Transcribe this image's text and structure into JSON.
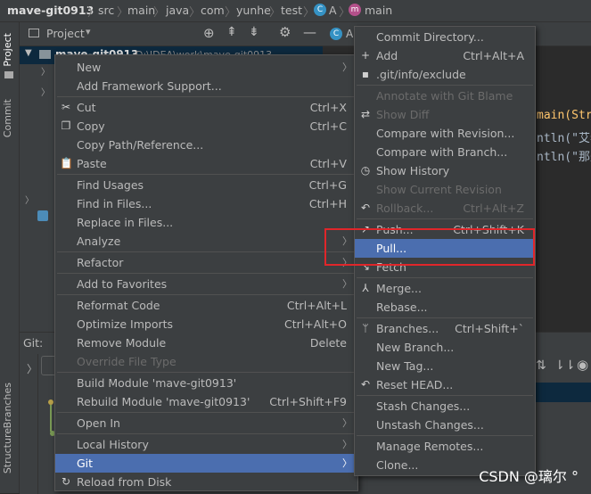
{
  "breadcrumb": [
    "mave-git0913",
    "src",
    "main",
    "java",
    "com",
    "yunhe",
    "test",
    "A",
    "main"
  ],
  "side_tabs": {
    "project": "Project",
    "commit": "Commit",
    "branches": "Branches",
    "structure": "Structure"
  },
  "project_panel": {
    "title": "Project",
    "root_name": "mave-git0913",
    "root_path": "D:\\IDEA\\work\\mave-git0913"
  },
  "editor": {
    "tab": "A",
    "line1": "main(Str",
    "line2": "ntln(\"艾老",
    "line3": "ntln(\"那是"
  },
  "git_panel": {
    "label": "Git:"
  },
  "context_menu": {
    "items": [
      {
        "label": "New",
        "arrow": true
      },
      {
        "label": "Add Framework Support..."
      },
      {
        "sep": true
      },
      {
        "label": "Cut",
        "shortcut": "Ctrl+X",
        "icon": "✂"
      },
      {
        "label": "Copy",
        "shortcut": "Ctrl+C",
        "icon": "❐"
      },
      {
        "label": "Copy Path/Reference..."
      },
      {
        "label": "Paste",
        "shortcut": "Ctrl+V",
        "icon": "📋"
      },
      {
        "sep": true
      },
      {
        "label": "Find Usages",
        "shortcut": "Ctrl+G"
      },
      {
        "label": "Find in Files...",
        "shortcut": "Ctrl+H"
      },
      {
        "label": "Replace in Files..."
      },
      {
        "label": "Analyze",
        "arrow": true
      },
      {
        "sep": true
      },
      {
        "label": "Refactor",
        "arrow": true
      },
      {
        "sep": true
      },
      {
        "label": "Add to Favorites",
        "arrow": true
      },
      {
        "sep": true
      },
      {
        "label": "Reformat Code",
        "shortcut": "Ctrl+Alt+L"
      },
      {
        "label": "Optimize Imports",
        "shortcut": "Ctrl+Alt+O"
      },
      {
        "label": "Remove Module",
        "shortcut": "Delete"
      },
      {
        "label": "Override File Type",
        "disabled": true
      },
      {
        "sep": true
      },
      {
        "label": "Build Module 'mave-git0913'"
      },
      {
        "label": "Rebuild Module 'mave-git0913'",
        "shortcut": "Ctrl+Shift+F9"
      },
      {
        "sep": true
      },
      {
        "label": "Open In",
        "arrow": true
      },
      {
        "sep": true
      },
      {
        "label": "Local History",
        "arrow": true
      },
      {
        "label": "Git",
        "arrow": true,
        "selected": true
      },
      {
        "label": "Reload from Disk",
        "icon": "↻"
      }
    ]
  },
  "git_submenu": {
    "items": [
      {
        "label": "Commit Directory..."
      },
      {
        "label": "Add",
        "shortcut": "Ctrl+Alt+A",
        "icon": "+"
      },
      {
        "label": ".git/info/exclude",
        "icon": "▪"
      },
      {
        "sep": true
      },
      {
        "label": "Annotate with Git Blame",
        "disabled": true
      },
      {
        "label": "Show Diff",
        "disabled": true,
        "icon": "⇄"
      },
      {
        "label": "Compare with Revision..."
      },
      {
        "label": "Compare with Branch..."
      },
      {
        "label": "Show History",
        "icon": "◷"
      },
      {
        "label": "Show Current Revision",
        "disabled": true
      },
      {
        "label": "Rollback...",
        "shortcut": "Ctrl+Alt+Z",
        "disabled": true,
        "icon": "↶"
      },
      {
        "sep": true
      },
      {
        "label": "Push...",
        "shortcut": "Ctrl+Shift+K",
        "icon": "↗"
      },
      {
        "label": "Pull...",
        "selected": true
      },
      {
        "label": "Fetch",
        "icon": "↘"
      },
      {
        "sep": true
      },
      {
        "label": "Merge...",
        "icon": "⅄"
      },
      {
        "label": "Rebase..."
      },
      {
        "sep": true
      },
      {
        "label": "Branches...",
        "shortcut": "Ctrl+Shift+`",
        "icon": "ᛘ"
      },
      {
        "label": "New Branch..."
      },
      {
        "label": "New Tag..."
      },
      {
        "label": "Reset HEAD...",
        "icon": "↶"
      },
      {
        "sep": true
      },
      {
        "label": "Stash Changes..."
      },
      {
        "label": "Unstash Changes..."
      },
      {
        "sep": true
      },
      {
        "label": "Manage Remotes..."
      },
      {
        "label": "Clone..."
      }
    ]
  },
  "watermark": "CSDN @璃尔 °",
  "colors": {
    "selection": "#4b6eaf",
    "highlight_box": "#e0262a",
    "menu_bg": "#3c3f41"
  }
}
